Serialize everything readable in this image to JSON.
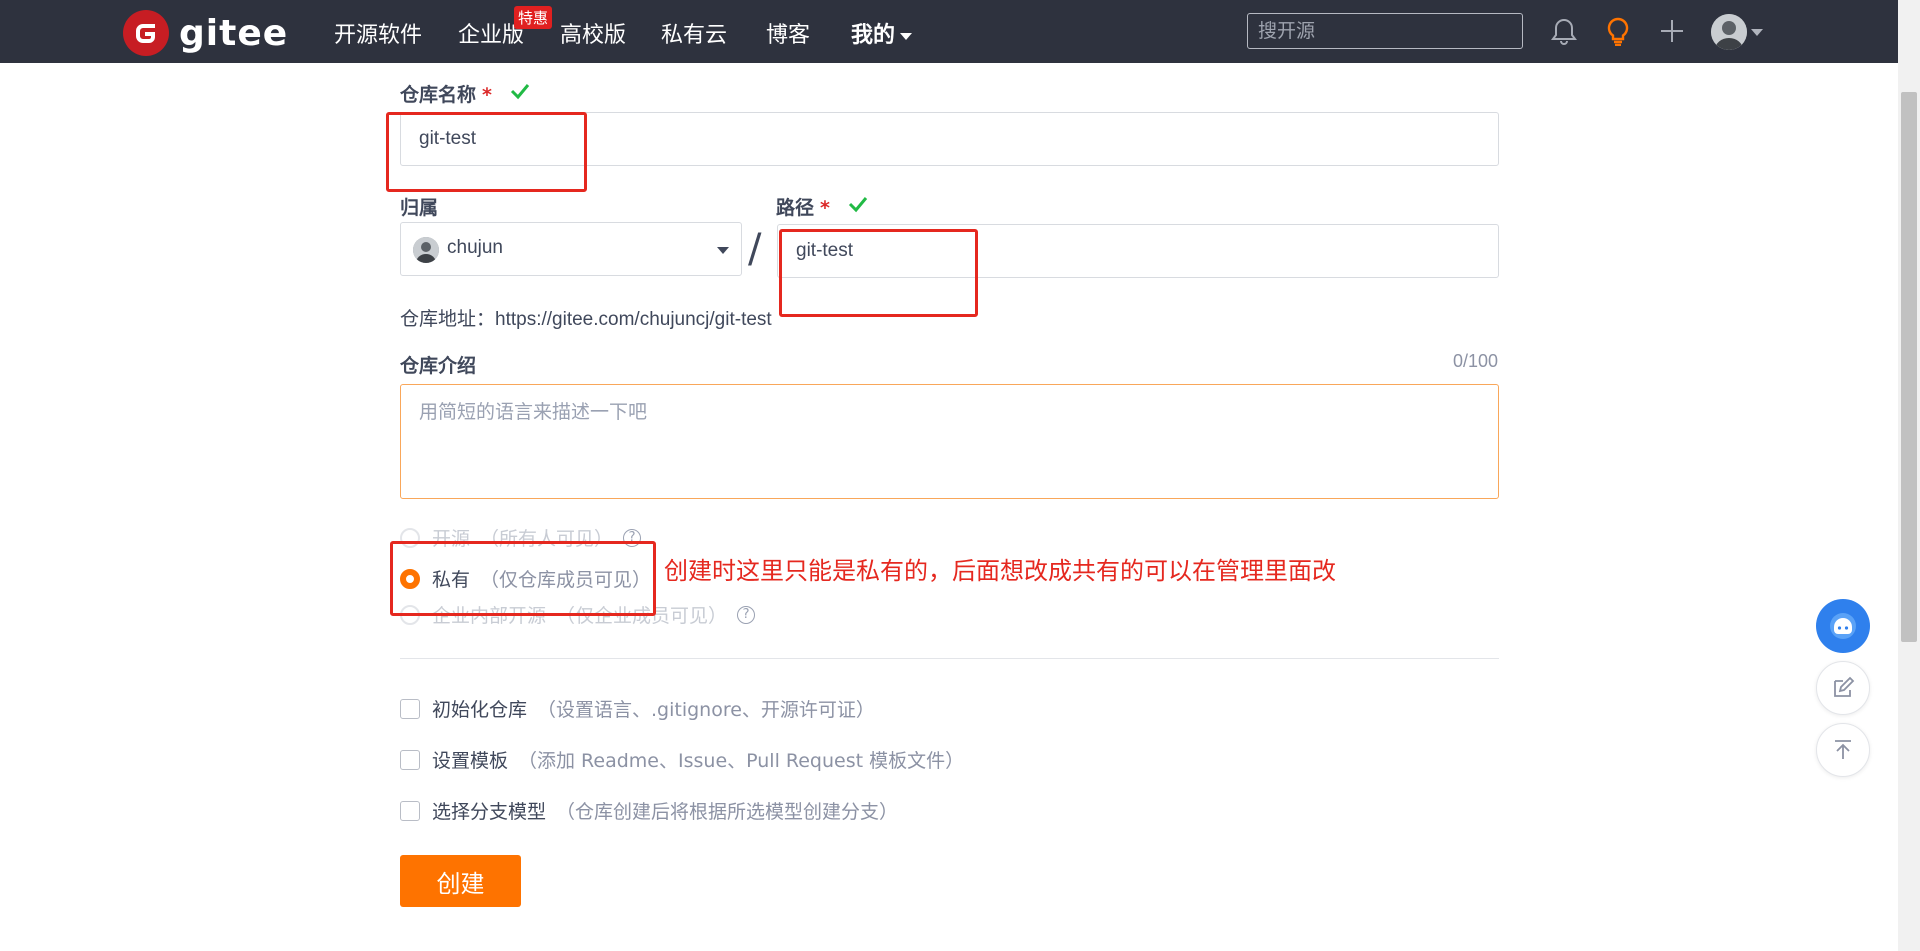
{
  "nav": {
    "logo_text": "gitee",
    "items": [
      {
        "label": "开源软件"
      },
      {
        "label": "企业版"
      },
      {
        "label": "高校版"
      },
      {
        "label": "私有云"
      },
      {
        "label": "博客"
      }
    ],
    "enterprise_badge": "特惠",
    "mine_label": "我的",
    "search_placeholder": "搜开源"
  },
  "form": {
    "repo_name_label": "仓库名称",
    "required_mark": "*",
    "repo_name_value": "git-test",
    "owner_label": "归属",
    "owner_value": "chujun",
    "path_label": "路径",
    "path_value": "git-test",
    "slash": "/",
    "repo_url_label": "仓库地址：",
    "repo_url_value": "https://gitee.com/chujuncj/git-test",
    "intro_label": "仓库介绍",
    "intro_counter": "0/100",
    "intro_placeholder": "用简短的语言来描述一下吧",
    "visibility": [
      {
        "label": "开源",
        "desc": "（所有人可见）",
        "selected": false,
        "disabled": true
      },
      {
        "label": "私有",
        "desc": "（仅仓库成员可见）",
        "selected": true,
        "disabled": false
      },
      {
        "label": "企业内部开源",
        "desc": "（仅企业成员可见）",
        "selected": false,
        "disabled": true
      }
    ],
    "options": [
      {
        "label": "初始化仓库",
        "desc": "（设置语言、.gitignore、开源许可证）",
        "checked": false
      },
      {
        "label": "设置模板",
        "desc": "（添加 Readme、Issue、Pull Request 模板文件）",
        "checked": false
      },
      {
        "label": "选择分支模型",
        "desc": "（仓库创建后将根据所选模型创建分支）",
        "checked": false
      }
    ],
    "create_button": "创建"
  },
  "annotation": {
    "text": "创建时这里只能是私有的，后面想改成共有的可以在管理里面改",
    "color": "#e5281f"
  },
  "colors": {
    "nav_bg": "#2e323e",
    "accent": "#fe7300",
    "brand": "#c71d23",
    "success": "#21ba45"
  }
}
